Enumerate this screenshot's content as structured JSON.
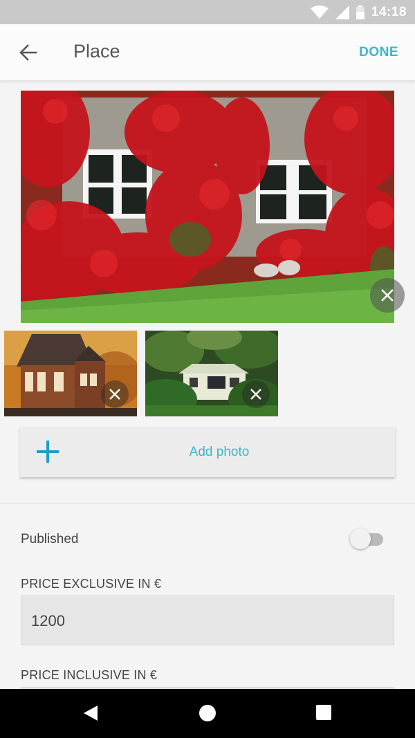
{
  "status_bar": {
    "time": "14:18"
  },
  "app_bar": {
    "title": "Place",
    "done_label": "DONE"
  },
  "photos": {
    "add_label": "Add photo"
  },
  "published": {
    "label": "Published",
    "enabled": false
  },
  "price_exclusive": {
    "label": "PRICE EXCLUSIVE IN €",
    "value": "1200"
  },
  "price_inclusive": {
    "label": "PRICE INCLUSIVE IN €",
    "value": ""
  },
  "colors": {
    "accent": "#3ab7c9",
    "status_bar": "#c9c9c9",
    "nav_bar": "#000000"
  }
}
